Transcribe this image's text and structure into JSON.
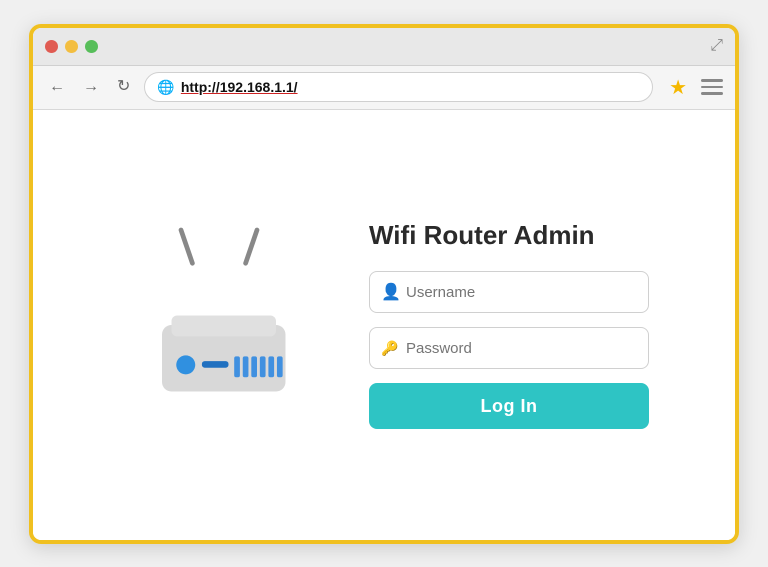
{
  "browser": {
    "url": "http://192.168.1.1/",
    "expand_icon": "⤢"
  },
  "nav": {
    "back": "←",
    "forward": "→",
    "refresh": "↻"
  },
  "page": {
    "title": "Wifi Router Admin",
    "username_placeholder": "Username",
    "password_placeholder": "Password",
    "login_button": "Log In"
  },
  "icons": {
    "user_icon": "👤",
    "key_icon": "🔑",
    "globe_icon": "🌐",
    "star_icon": "★"
  }
}
